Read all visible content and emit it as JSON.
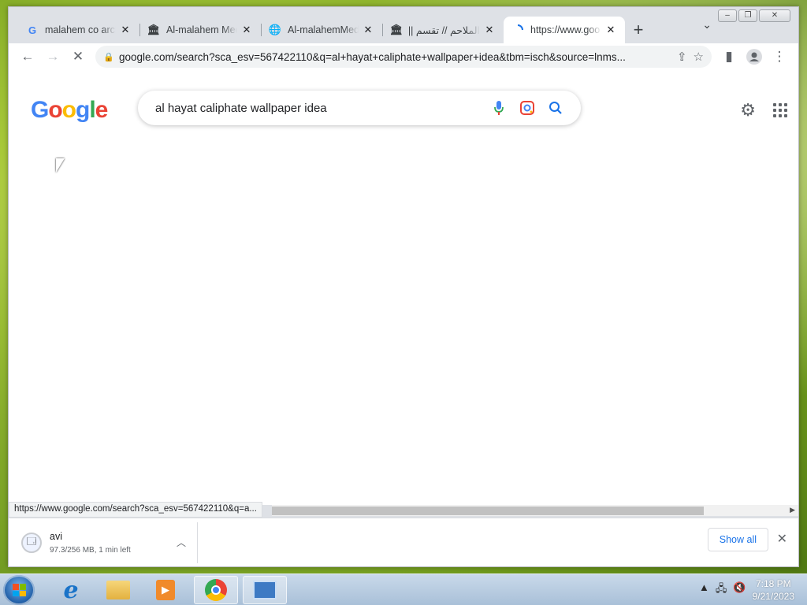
{
  "browser": {
    "tabs": [
      {
        "title": "malahem co arch",
        "favicon": "google-g-icon",
        "active": false
      },
      {
        "title": "Al-malahem Med",
        "favicon": "archive-icon",
        "active": false
      },
      {
        "title": "Al-malahemMed",
        "favicon": "globe-icon",
        "active": false
      },
      {
        "title": "الملاحم // تقسم || اللقاء",
        "favicon": "archive-icon",
        "active": false
      },
      {
        "title": "https://www.goo",
        "favicon": "loading-spinner-icon",
        "active": true
      }
    ],
    "new_tab_label": "+",
    "omnibox": {
      "url": "google.com/search?sca_esv=567422110&q=al+hayat+caliphate+wallpaper+idea&tbm=isch&source=lnms..."
    }
  },
  "google": {
    "logo": [
      "G",
      "o",
      "o",
      "g",
      "l",
      "e"
    ],
    "query": "al hayat caliphate wallpaper idea"
  },
  "status_bar": {
    "text": "https://www.google.com/search?sca_esv=567422110&q=a..."
  },
  "downloads": {
    "item": {
      "name": "avi",
      "status": "97.3/256 MB, 1 min left"
    },
    "show_all_label": "Show all"
  },
  "taskbar": {
    "time": "7:18 PM",
    "date": "9/21/2023"
  }
}
